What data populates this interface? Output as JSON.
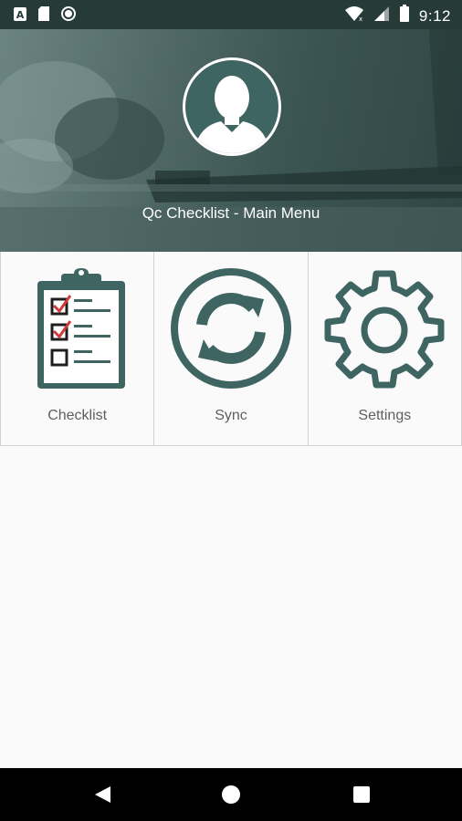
{
  "status_bar": {
    "time": "9:12",
    "left_icons": [
      "notification-a-icon",
      "sd-card-icon",
      "record-icon"
    ],
    "right_icons": [
      "wifi-icon",
      "signal-icon",
      "battery-icon"
    ]
  },
  "header": {
    "title": "Qc Checklist - Main Menu",
    "avatar_icon": "user-avatar-icon"
  },
  "menu": {
    "items": [
      {
        "label": "Checklist",
        "icon": "clipboard-checklist-icon"
      },
      {
        "label": "Sync",
        "icon": "sync-icon"
      },
      {
        "label": "Settings",
        "icon": "gear-icon"
      }
    ]
  },
  "nav_bar": {
    "buttons": [
      "back-icon",
      "home-icon",
      "recents-icon"
    ]
  },
  "colors": {
    "status_bar": "#263b38",
    "accent": "#3f6562",
    "check_red": "#d23b3b",
    "label_gray": "#5f5f5f"
  }
}
